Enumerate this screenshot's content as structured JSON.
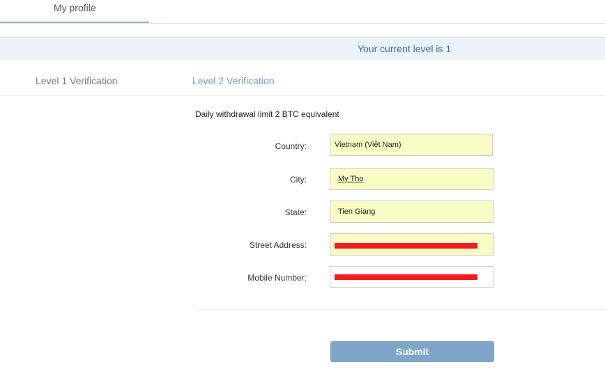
{
  "tabs": {
    "profile_label": "My profile"
  },
  "banner": {
    "text": "Your current level is 1"
  },
  "verification_tabs": {
    "level1": "Level 1 Verification",
    "level2": "Level 2 Verification"
  },
  "form": {
    "limit_text": "Daily withdrawal limit 2 BTC equivalent",
    "fields": {
      "country": {
        "label": "Country:",
        "value": "Vietnam (Việt Nam)"
      },
      "city": {
        "label": "City:",
        "value": "My Tho"
      },
      "state": {
        "label": "State:",
        "value": "Tien Giang"
      },
      "street": {
        "label": "Street Address:"
      },
      "mobile": {
        "label": "Mobile Number:"
      }
    },
    "submit_label": "Submit"
  },
  "colors": {
    "accent": "#7fa6c8",
    "field_autofill": "#fafcc5",
    "redaction": "#f21c1c"
  }
}
